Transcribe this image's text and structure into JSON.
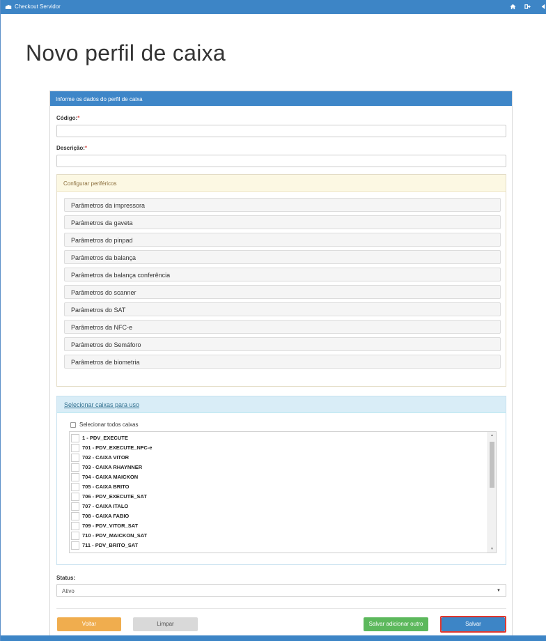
{
  "app": {
    "title": "Checkout Servidor"
  },
  "topbar": {
    "icons": [
      "home-icon",
      "logout-icon",
      "back-icon"
    ]
  },
  "page": {
    "title": "Novo perfil de caixa"
  },
  "form": {
    "panel_title": "Informe os dados do perfil de caixa",
    "codigo_label": "Código:",
    "codigo_value": "",
    "descricao_label": "Descrição:",
    "descricao_value": "",
    "required_marker": "*"
  },
  "perifericos": {
    "title": "Configurar periféricos",
    "items": [
      "Parâmetros da impressora",
      "Parâmetros da gaveta",
      "Parâmetros do pinpad",
      "Parâmetros da balança",
      "Parâmetros da balança conferência",
      "Parâmetros do scanner",
      "Parâmetros do SAT",
      "Parâmetros da NFC-e",
      "Parâmetros do Semáforo",
      "Parâmetros de biometria"
    ]
  },
  "caixas": {
    "title": "Selecionar caixas para uso",
    "select_all_label": "Selecionar todos caixas",
    "items": [
      "1 - PDV_EXECUTE",
      "701 - PDV_EXECUTE_NFC-e",
      "702 - CAIXA VITOR",
      "703 - CAIXA RHAYNNER",
      "704 - CAIXA MAICKON",
      "705 - CAIXA BRITO",
      "706 - PDV_EXECUTE_SAT",
      "707 - CAIXA ITALO",
      "708 - CAIXA FABIO",
      "709 - PDV_VITOR_SAT",
      "710 - PDV_MAICKON_SAT",
      "711 - PDV_BRITO_SAT"
    ]
  },
  "status": {
    "label": "Status:",
    "value": "Ativo"
  },
  "buttons": {
    "voltar": "Voltar",
    "limpar": "Limpar",
    "salvar_adicionar": "Salvar adicionar outro",
    "salvar": "Salvar"
  },
  "colors": {
    "primary": "#3d85c6",
    "warning": "#f0ad4e",
    "success": "#5cb85c",
    "required": "#d9534f",
    "focus": "#e0382f"
  }
}
